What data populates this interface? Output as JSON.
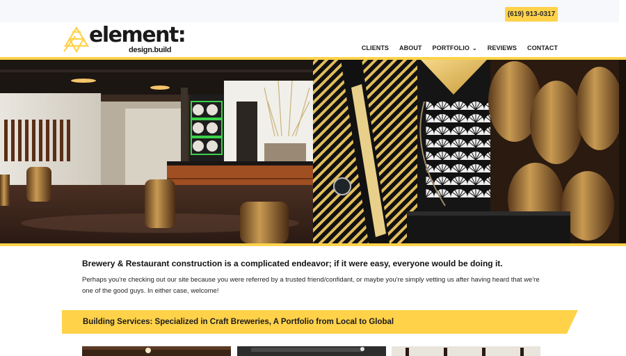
{
  "header": {
    "phone": "(619) 913-0317",
    "logo_text": "element:",
    "logo_sub": "design.build"
  },
  "nav": {
    "items": [
      {
        "label": "CLIENTS"
      },
      {
        "label": "ABOUT"
      },
      {
        "label": "PORTFOLIO",
        "has_dropdown": true
      },
      {
        "label": "REVIEWS"
      },
      {
        "label": "CONTACT"
      }
    ]
  },
  "hero": {
    "scene": "brewery-interior-photo"
  },
  "main": {
    "headline": "Brewery & Restaurant construction is a complicated endeavor; if it were easy, everyone would be doing it.",
    "intro": "Perhaps you're checking out our site because you were referred by a trusted friend/confidant, or maybe you're simply vetting us after having heard that we're one of the good guys. In either case, welcome!"
  },
  "services": {
    "banner": "Building Services: Specialized in Craft Breweries, A Portfolio from Local to Global"
  },
  "colors": {
    "accent": "#ffd24a",
    "text": "#1b1b1b"
  },
  "icons": {
    "logo_mark": "triangle-logo-icon",
    "dropdown": "chevron-down-icon"
  }
}
